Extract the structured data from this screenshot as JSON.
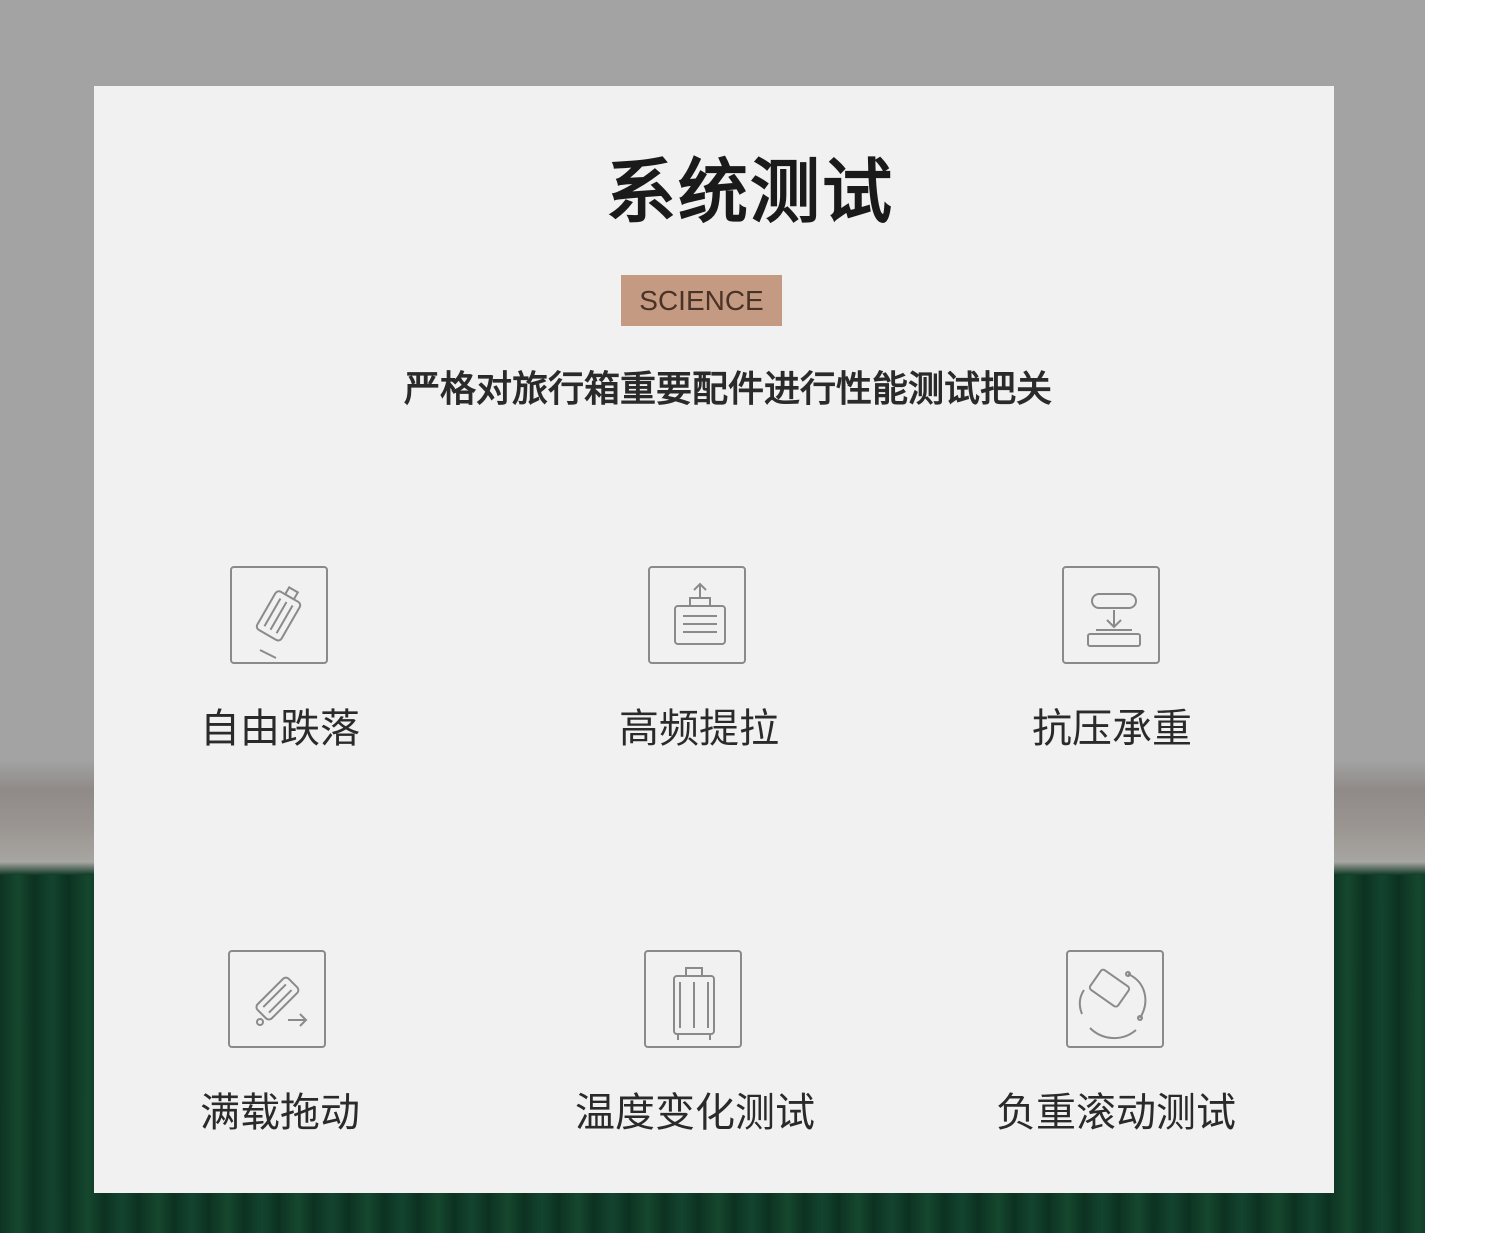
{
  "header": {
    "title": "系统测试",
    "badge": "SCIENCE",
    "subtitle": "严格对旅行箱重要配件进行性能测试把关"
  },
  "features": [
    {
      "label": "自由跌落",
      "icon": "falling-suitcase-icon"
    },
    {
      "label": "高频提拉",
      "icon": "handle-pull-icon"
    },
    {
      "label": "抗压承重",
      "icon": "compression-icon"
    },
    {
      "label": "满载拖动",
      "icon": "drag-suitcase-icon"
    },
    {
      "label": "温度变化测试",
      "icon": "upright-suitcase-icon"
    },
    {
      "label": "负重滚动测试",
      "icon": "rolling-suitcase-icon"
    }
  ],
  "colors": {
    "card_background": "#f1f1f1",
    "badge_background": "#c49a83",
    "badge_text": "#4a3326",
    "icon_stroke": "#8a8a8a",
    "backdrop_gray": "#a3a3a3",
    "backdrop_green": "#0f3b27"
  }
}
